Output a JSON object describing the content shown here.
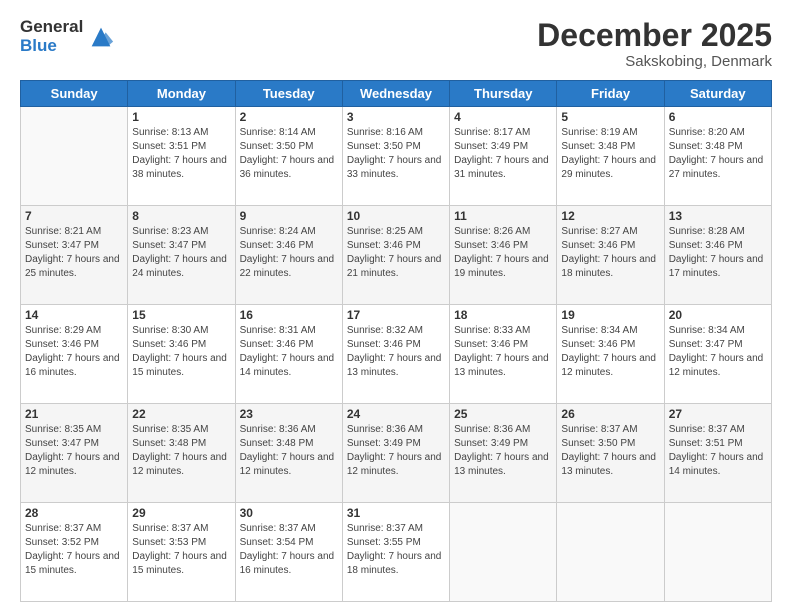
{
  "logo": {
    "general": "General",
    "blue": "Blue"
  },
  "header": {
    "month": "December 2025",
    "location": "Sakskobing, Denmark"
  },
  "weekdays": [
    "Sunday",
    "Monday",
    "Tuesday",
    "Wednesday",
    "Thursday",
    "Friday",
    "Saturday"
  ],
  "weeks": [
    [
      {
        "date": "",
        "sunrise": "",
        "sunset": "",
        "daylight": ""
      },
      {
        "date": "1",
        "sunrise": "Sunrise: 8:13 AM",
        "sunset": "Sunset: 3:51 PM",
        "daylight": "Daylight: 7 hours and 38 minutes."
      },
      {
        "date": "2",
        "sunrise": "Sunrise: 8:14 AM",
        "sunset": "Sunset: 3:50 PM",
        "daylight": "Daylight: 7 hours and 36 minutes."
      },
      {
        "date": "3",
        "sunrise": "Sunrise: 8:16 AM",
        "sunset": "Sunset: 3:50 PM",
        "daylight": "Daylight: 7 hours and 33 minutes."
      },
      {
        "date": "4",
        "sunrise": "Sunrise: 8:17 AM",
        "sunset": "Sunset: 3:49 PM",
        "daylight": "Daylight: 7 hours and 31 minutes."
      },
      {
        "date": "5",
        "sunrise": "Sunrise: 8:19 AM",
        "sunset": "Sunset: 3:48 PM",
        "daylight": "Daylight: 7 hours and 29 minutes."
      },
      {
        "date": "6",
        "sunrise": "Sunrise: 8:20 AM",
        "sunset": "Sunset: 3:48 PM",
        "daylight": "Daylight: 7 hours and 27 minutes."
      }
    ],
    [
      {
        "date": "7",
        "sunrise": "Sunrise: 8:21 AM",
        "sunset": "Sunset: 3:47 PM",
        "daylight": "Daylight: 7 hours and 25 minutes."
      },
      {
        "date": "8",
        "sunrise": "Sunrise: 8:23 AM",
        "sunset": "Sunset: 3:47 PM",
        "daylight": "Daylight: 7 hours and 24 minutes."
      },
      {
        "date": "9",
        "sunrise": "Sunrise: 8:24 AM",
        "sunset": "Sunset: 3:46 PM",
        "daylight": "Daylight: 7 hours and 22 minutes."
      },
      {
        "date": "10",
        "sunrise": "Sunrise: 8:25 AM",
        "sunset": "Sunset: 3:46 PM",
        "daylight": "Daylight: 7 hours and 21 minutes."
      },
      {
        "date": "11",
        "sunrise": "Sunrise: 8:26 AM",
        "sunset": "Sunset: 3:46 PM",
        "daylight": "Daylight: 7 hours and 19 minutes."
      },
      {
        "date": "12",
        "sunrise": "Sunrise: 8:27 AM",
        "sunset": "Sunset: 3:46 PM",
        "daylight": "Daylight: 7 hours and 18 minutes."
      },
      {
        "date": "13",
        "sunrise": "Sunrise: 8:28 AM",
        "sunset": "Sunset: 3:46 PM",
        "daylight": "Daylight: 7 hours and 17 minutes."
      }
    ],
    [
      {
        "date": "14",
        "sunrise": "Sunrise: 8:29 AM",
        "sunset": "Sunset: 3:46 PM",
        "daylight": "Daylight: 7 hours and 16 minutes."
      },
      {
        "date": "15",
        "sunrise": "Sunrise: 8:30 AM",
        "sunset": "Sunset: 3:46 PM",
        "daylight": "Daylight: 7 hours and 15 minutes."
      },
      {
        "date": "16",
        "sunrise": "Sunrise: 8:31 AM",
        "sunset": "Sunset: 3:46 PM",
        "daylight": "Daylight: 7 hours and 14 minutes."
      },
      {
        "date": "17",
        "sunrise": "Sunrise: 8:32 AM",
        "sunset": "Sunset: 3:46 PM",
        "daylight": "Daylight: 7 hours and 13 minutes."
      },
      {
        "date": "18",
        "sunrise": "Sunrise: 8:33 AM",
        "sunset": "Sunset: 3:46 PM",
        "daylight": "Daylight: 7 hours and 13 minutes."
      },
      {
        "date": "19",
        "sunrise": "Sunrise: 8:34 AM",
        "sunset": "Sunset: 3:46 PM",
        "daylight": "Daylight: 7 hours and 12 minutes."
      },
      {
        "date": "20",
        "sunrise": "Sunrise: 8:34 AM",
        "sunset": "Sunset: 3:47 PM",
        "daylight": "Daylight: 7 hours and 12 minutes."
      }
    ],
    [
      {
        "date": "21",
        "sunrise": "Sunrise: 8:35 AM",
        "sunset": "Sunset: 3:47 PM",
        "daylight": "Daylight: 7 hours and 12 minutes."
      },
      {
        "date": "22",
        "sunrise": "Sunrise: 8:35 AM",
        "sunset": "Sunset: 3:48 PM",
        "daylight": "Daylight: 7 hours and 12 minutes."
      },
      {
        "date": "23",
        "sunrise": "Sunrise: 8:36 AM",
        "sunset": "Sunset: 3:48 PM",
        "daylight": "Daylight: 7 hours and 12 minutes."
      },
      {
        "date": "24",
        "sunrise": "Sunrise: 8:36 AM",
        "sunset": "Sunset: 3:49 PM",
        "daylight": "Daylight: 7 hours and 12 minutes."
      },
      {
        "date": "25",
        "sunrise": "Sunrise: 8:36 AM",
        "sunset": "Sunset: 3:49 PM",
        "daylight": "Daylight: 7 hours and 13 minutes."
      },
      {
        "date": "26",
        "sunrise": "Sunrise: 8:37 AM",
        "sunset": "Sunset: 3:50 PM",
        "daylight": "Daylight: 7 hours and 13 minutes."
      },
      {
        "date": "27",
        "sunrise": "Sunrise: 8:37 AM",
        "sunset": "Sunset: 3:51 PM",
        "daylight": "Daylight: 7 hours and 14 minutes."
      }
    ],
    [
      {
        "date": "28",
        "sunrise": "Sunrise: 8:37 AM",
        "sunset": "Sunset: 3:52 PM",
        "daylight": "Daylight: 7 hours and 15 minutes."
      },
      {
        "date": "29",
        "sunrise": "Sunrise: 8:37 AM",
        "sunset": "Sunset: 3:53 PM",
        "daylight": "Daylight: 7 hours and 15 minutes."
      },
      {
        "date": "30",
        "sunrise": "Sunrise: 8:37 AM",
        "sunset": "Sunset: 3:54 PM",
        "daylight": "Daylight: 7 hours and 16 minutes."
      },
      {
        "date": "31",
        "sunrise": "Sunrise: 8:37 AM",
        "sunset": "Sunset: 3:55 PM",
        "daylight": "Daylight: 7 hours and 18 minutes."
      },
      {
        "date": "",
        "sunrise": "",
        "sunset": "",
        "daylight": ""
      },
      {
        "date": "",
        "sunrise": "",
        "sunset": "",
        "daylight": ""
      },
      {
        "date": "",
        "sunrise": "",
        "sunset": "",
        "daylight": ""
      }
    ]
  ]
}
